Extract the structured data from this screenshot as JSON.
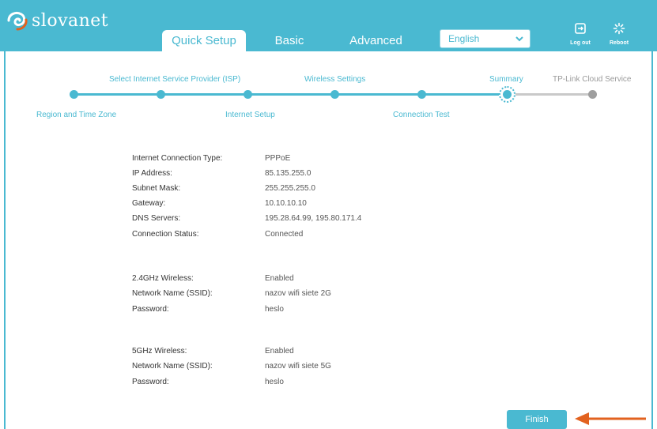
{
  "brand": {
    "name": "slovanet",
    "logo_icon": "swirl-logo-icon"
  },
  "nav": {
    "tabs": [
      {
        "label": "Quick Setup",
        "active": true
      },
      {
        "label": "Basic",
        "active": false
      },
      {
        "label": "Advanced",
        "active": false
      }
    ],
    "language": {
      "selected": "English"
    },
    "logout_label": "Log out",
    "reboot_label": "Reboot"
  },
  "colors": {
    "accent": "#4ab9d1",
    "inactive": "#9e9e9e",
    "arrow": "#e2621f"
  },
  "stepper": {
    "steps": [
      {
        "label": "Region and Time Zone",
        "status": "done"
      },
      {
        "label": "Select Internet Service Provider (ISP)",
        "status": "done"
      },
      {
        "label": "Internet Setup",
        "status": "done"
      },
      {
        "label": "Wireless Settings",
        "status": "done"
      },
      {
        "label": "Connection Test",
        "status": "done"
      },
      {
        "label": "Summary",
        "status": "current"
      },
      {
        "label": "TP-Link Cloud Service",
        "status": "pending"
      }
    ]
  },
  "summary": {
    "internet": [
      {
        "label": "Internet Connection Type:",
        "value": "PPPoE"
      },
      {
        "label": "IP Address:",
        "value": "85.135.255.0"
      },
      {
        "label": "Subnet Mask:",
        "value": "255.255.255.0"
      },
      {
        "label": "Gateway:",
        "value": "10.10.10.10"
      },
      {
        "label": "DNS Servers:",
        "value": "195.28.64.99, 195.80.171.4"
      },
      {
        "label": "Connection Status:",
        "value": "Connected"
      }
    ],
    "wifi_24": [
      {
        "label": "2.4GHz Wireless:",
        "value": "Enabled"
      },
      {
        "label": "Network Name (SSID):",
        "value": "nazov wifi siete 2G"
      },
      {
        "label": "Password:",
        "value": "heslo"
      }
    ],
    "wifi_5": [
      {
        "label": "5GHz Wireless:",
        "value": "Enabled"
      },
      {
        "label": "Network Name (SSID):",
        "value": "nazov wifi siete 5G"
      },
      {
        "label": "Password:",
        "value": "heslo"
      }
    ]
  },
  "footer": {
    "finish_label": "Finish"
  }
}
